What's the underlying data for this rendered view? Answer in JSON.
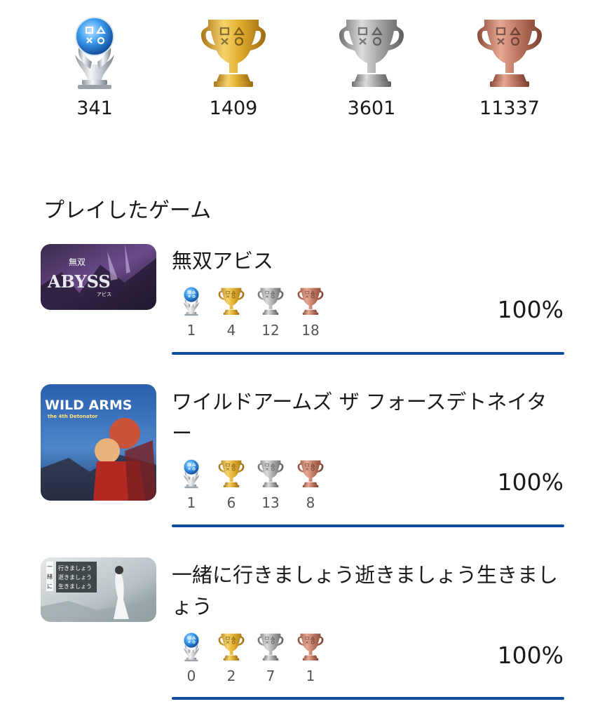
{
  "summary": {
    "platinum": "341",
    "gold": "1409",
    "silver": "3601",
    "bronze": "11337"
  },
  "trophy_icons": {
    "platinum": "platinum-trophy-icon",
    "gold": "gold-trophy-icon",
    "silver": "silver-trophy-icon",
    "bronze": "bronze-trophy-icon"
  },
  "colors": {
    "progress_bar": "#0f4c9b",
    "platinum_accent": "#2f7fe0",
    "gold": "#d9a520",
    "silver": "#a8a8a8",
    "bronze": "#b8705a"
  },
  "section_title": "プレイしたゲーム",
  "games": [
    {
      "title": "無双アビス",
      "platinum": "1",
      "gold": "4",
      "silver": "12",
      "bronze": "18",
      "progress": "100%",
      "progress_value": 100,
      "cover_text": [
        "無双",
        "ABYSS",
        "アビス"
      ]
    },
    {
      "title": "ワイルドアームズ ザ フォースデトネイター",
      "platinum": "1",
      "gold": "6",
      "silver": "13",
      "bronze": "8",
      "progress": "100%",
      "progress_value": 100,
      "cover_text": [
        "WILD ARMS",
        "the 4th Detonator"
      ]
    },
    {
      "title": "一緒に行きましょう逝きましょう生きましょう",
      "platinum": "0",
      "gold": "2",
      "silver": "7",
      "bronze": "1",
      "progress": "100%",
      "progress_value": 100,
      "cover_text": [
        "一",
        "緒",
        "に",
        "行きましょう",
        "逝きましょう",
        "生きましょう"
      ]
    }
  ]
}
